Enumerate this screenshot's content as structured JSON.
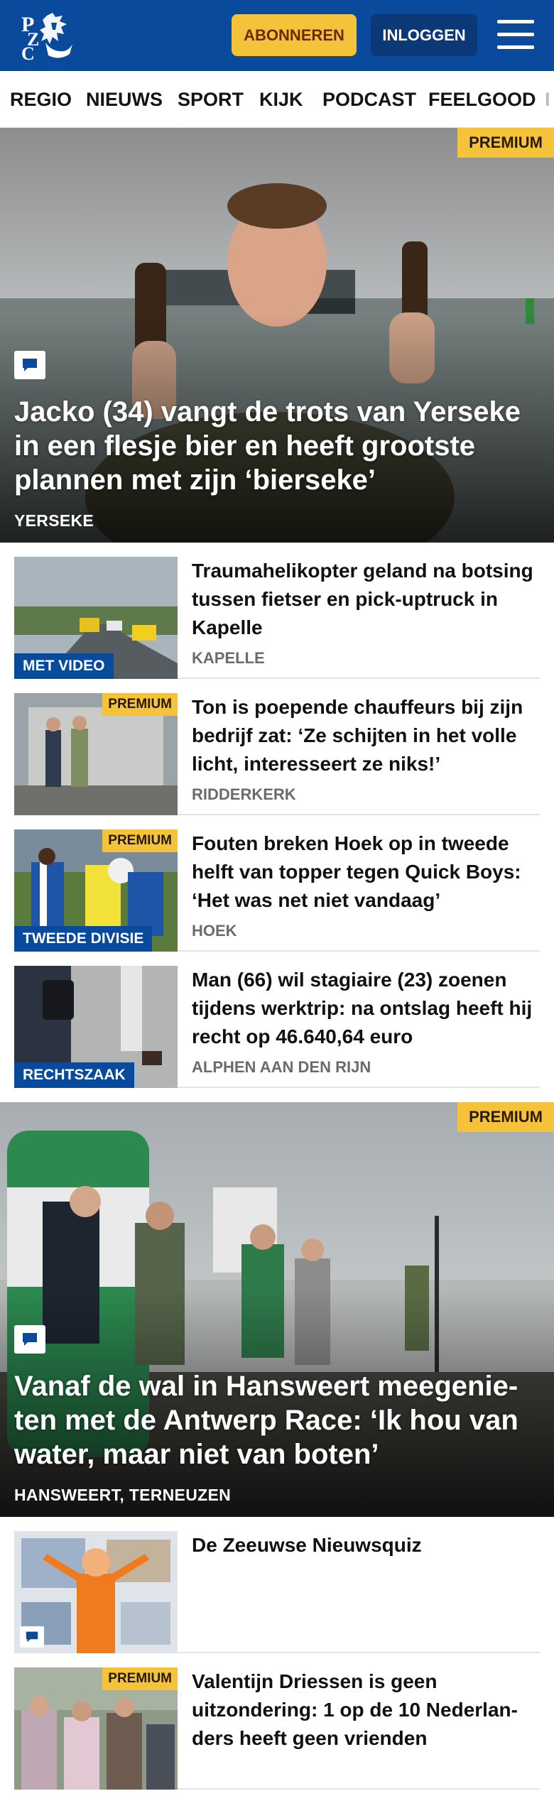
{
  "header": {
    "logo_text": "PZC",
    "subscribe_label": "ABONNEREN",
    "login_label": "INLOGGEN",
    "menu_icon": "hamburger-menu-icon"
  },
  "nav": {
    "items": [
      "REGIO",
      "NIEUWS",
      "SPORT",
      "KIJK",
      "PODCAST",
      "FEELGOOD",
      "I"
    ]
  },
  "hero1": {
    "badge": "PREMIUM",
    "title": "Jacko (34) vangt de trots van Yerseke in een flesje bier en heeft grootste plannen met zijn ‘bierseke’",
    "location": "YERSEKE",
    "icon": "comment-icon"
  },
  "articles1": [
    {
      "label": "MET VIDEO",
      "title": "Traumahelikopter geland na botsing tussen fietser en pick-uptruck in Kapelle",
      "location": "KAPELLE"
    },
    {
      "badge": "PREMIUM",
      "title": "Ton is poepende chauffeurs bij zijn bedrijf zat: ‘Ze schijten in het volle licht, interesseert ze niks!’",
      "location": "RIDDERKERK"
    },
    {
      "badge": "PREMIUM",
      "label": "TWEEDE DIVISIE",
      "title": "Fouten breken Hoek op in tweede helft van topper tegen Quick Boys: ‘Het was net niet vandaag’",
      "location": "HOEK"
    },
    {
      "label": "RECHTSZAAK",
      "title": "Man (66) wil stagiaire (23) zoenen tijdens werktrip: na ontslag heeft hij recht op 46.640,64 euro",
      "location": "ALPHEN AAN DEN RIJN"
    }
  ],
  "hero2": {
    "badge": "PREMIUM",
    "title": "Vanaf de wal in Hansweert meegenie- ten met de Antwerp Race: ‘Ik hou van water, maar niet van boten’",
    "location": "HANSWEERT, TERNEUZEN",
    "icon": "comment-icon"
  },
  "articles2": [
    {
      "title": "De Zeeuwse Nieuwsquiz",
      "icon": "comment-icon"
    },
    {
      "badge": "PREMIUM",
      "title": "Valentijn Driessen is geen uitzondering: 1 op de 10 Nederlan- ders heeft geen vrienden"
    }
  ],
  "colors": {
    "brand_blue": "#0a4a9c",
    "login_blue": "#0b3877",
    "premium_yellow": "#f5c33a",
    "location_grey": "#6b6b6b"
  }
}
